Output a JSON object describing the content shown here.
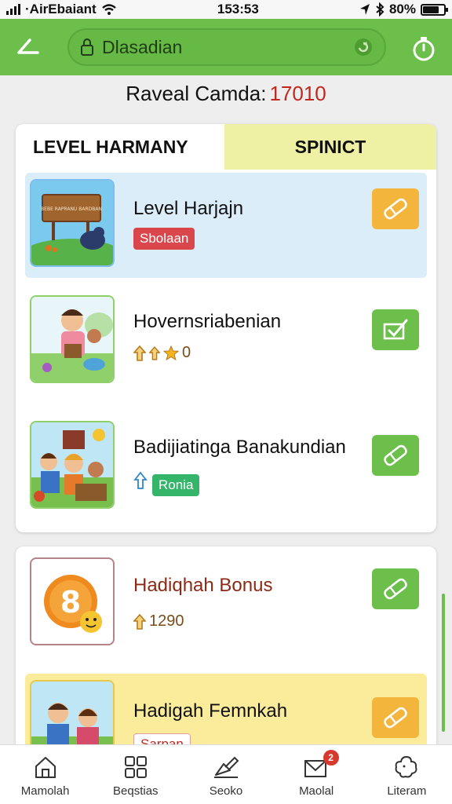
{
  "status": {
    "carrier": "·AirEbaiant",
    "time": "153:53",
    "battery": "80%",
    "battery_level": 0.8
  },
  "header": {
    "url": "Dlasadian"
  },
  "reveal": {
    "label": "Raveal Camda:",
    "value": "17010"
  },
  "tabs": [
    {
      "label": "LEVEL HARMANY"
    },
    {
      "label": "SPINICT"
    }
  ],
  "rows": [
    {
      "title": "Level Harjajn",
      "badge": "Sbolaan",
      "thumb_text": "BEBE RAPRANU BARDBAN"
    },
    {
      "title": "Hovernsriabenian",
      "meta": "0"
    },
    {
      "title": "Badijiatinga Banakundian",
      "badge": "Ronia"
    }
  ],
  "bonus_rows": [
    {
      "title": "Hadiqhah Bonus",
      "meta": "1290",
      "coin": "8"
    },
    {
      "title": "Hadigah Femnkah",
      "badge": "Sarpan"
    }
  ],
  "nav": {
    "items": [
      {
        "label": "Mamolah"
      },
      {
        "label": "Beqstias"
      },
      {
        "label": "Seoko"
      },
      {
        "label": "Maolal",
        "badge": "2"
      },
      {
        "label": "Literam"
      }
    ]
  },
  "colors": {
    "primary": "#6cbf4a",
    "accent_orange": "#f4b53d",
    "red": "#d9474c",
    "highlight_blue": "#dcedfa",
    "highlight_yellow": "#faec9a"
  }
}
